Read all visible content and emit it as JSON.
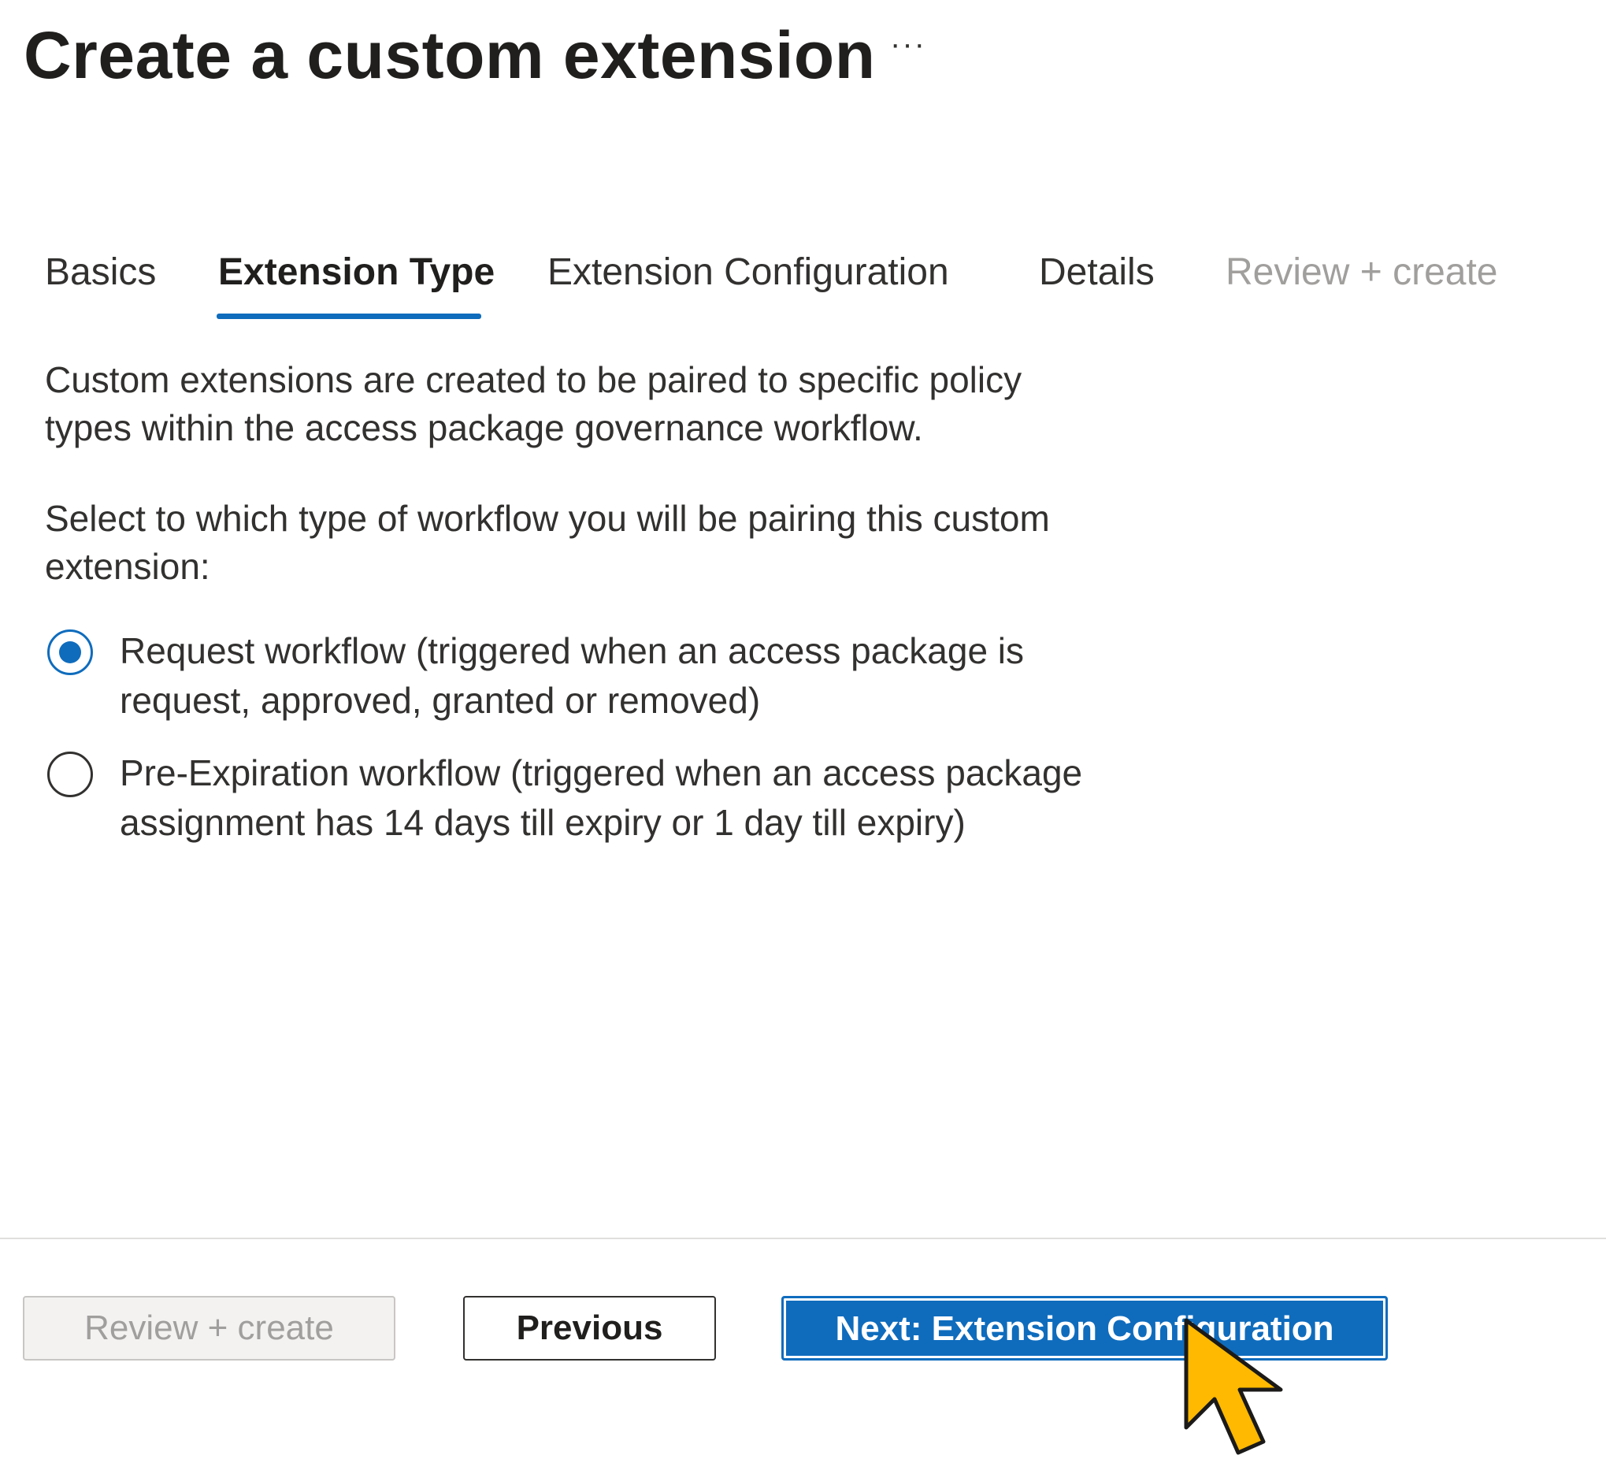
{
  "header": {
    "title": "Create a custom extension",
    "more_label": "···"
  },
  "tabs": [
    {
      "label": "Basics",
      "state": "default"
    },
    {
      "label": "Extension Type",
      "state": "active"
    },
    {
      "label": "Extension Configuration",
      "state": "default"
    },
    {
      "label": "Details",
      "state": "default"
    },
    {
      "label": "Review + create",
      "state": "disabled"
    }
  ],
  "main": {
    "intro_text": "Custom extensions are created to be paired to specific policy types within the access package governance workflow.",
    "select_prompt": "Select to which type of workflow you will be pairing this custom extension:",
    "workflow_options": [
      {
        "label": "Request workflow (triggered when an access package is request, approved, granted or removed)",
        "checked": true
      },
      {
        "label": "Pre-Expiration workflow (triggered when an access package assignment has 14 days till expiry or 1 day till expiry)",
        "checked": false
      }
    ]
  },
  "footer": {
    "review_create_label": "Review + create",
    "previous_label": "Previous",
    "next_label": "Next: Extension Configuration"
  },
  "colors": {
    "accent": "#0f6cbd",
    "text": "#323130",
    "disabled_text": "#a19f9d",
    "cursor_fill": "#ffb900"
  }
}
